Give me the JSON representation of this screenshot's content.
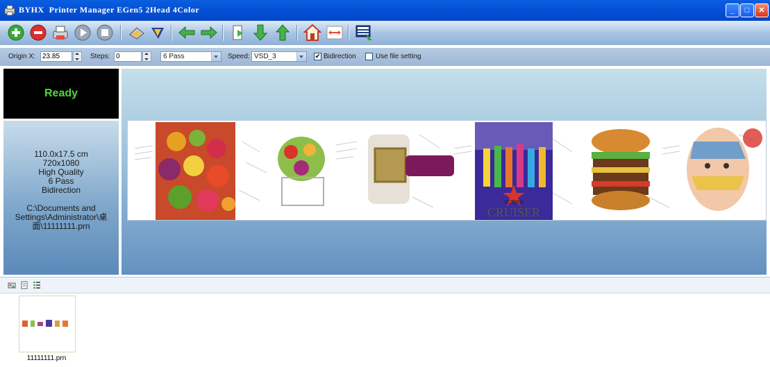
{
  "window": {
    "title": "BYHX  Printer Manager EGen5 2Head 4Color",
    "buttons": {
      "minimize": "_",
      "maximize": "□",
      "close": "✕"
    }
  },
  "toolbar": {
    "icons": [
      "add-icon",
      "remove-icon",
      "print-icon",
      "resume-icon",
      "stop-icon",
      "clean-icon",
      "calibrate-icon",
      "move-left-icon",
      "move-right-icon",
      "feed-paper-icon",
      "move-down-icon",
      "move-up-icon",
      "home-icon",
      "measure-width-icon",
      "settings-icon"
    ]
  },
  "options": {
    "origin_x_label": "Origin X:",
    "origin_x_value": "23.85",
    "steps_label": "Steps:",
    "steps_value": "0",
    "pass_value": "6 Pass",
    "speed_label": "Speed:",
    "speed_value": "VSD_3",
    "bidirection_label": "Bidirection",
    "bidirection_checked": "✔",
    "use_file_label": "Use file setting"
  },
  "status": {
    "text": "Ready"
  },
  "job_info": {
    "size": "110.0x17.5 cm",
    "resolution": "720x1080",
    "quality": "High Quality",
    "pass": "6 Pass",
    "direction": "Bidirection",
    "path_line1": "C:\\Documents and",
    "path_line2": "Settings\\Administrator\\桌",
    "path_line3": "面\\11111111.prn"
  },
  "preview": {
    "brand_small": "VODKA",
    "brand_large": "CRUISER"
  },
  "thumbnails": [
    {
      "label": "11111111.prn"
    }
  ]
}
